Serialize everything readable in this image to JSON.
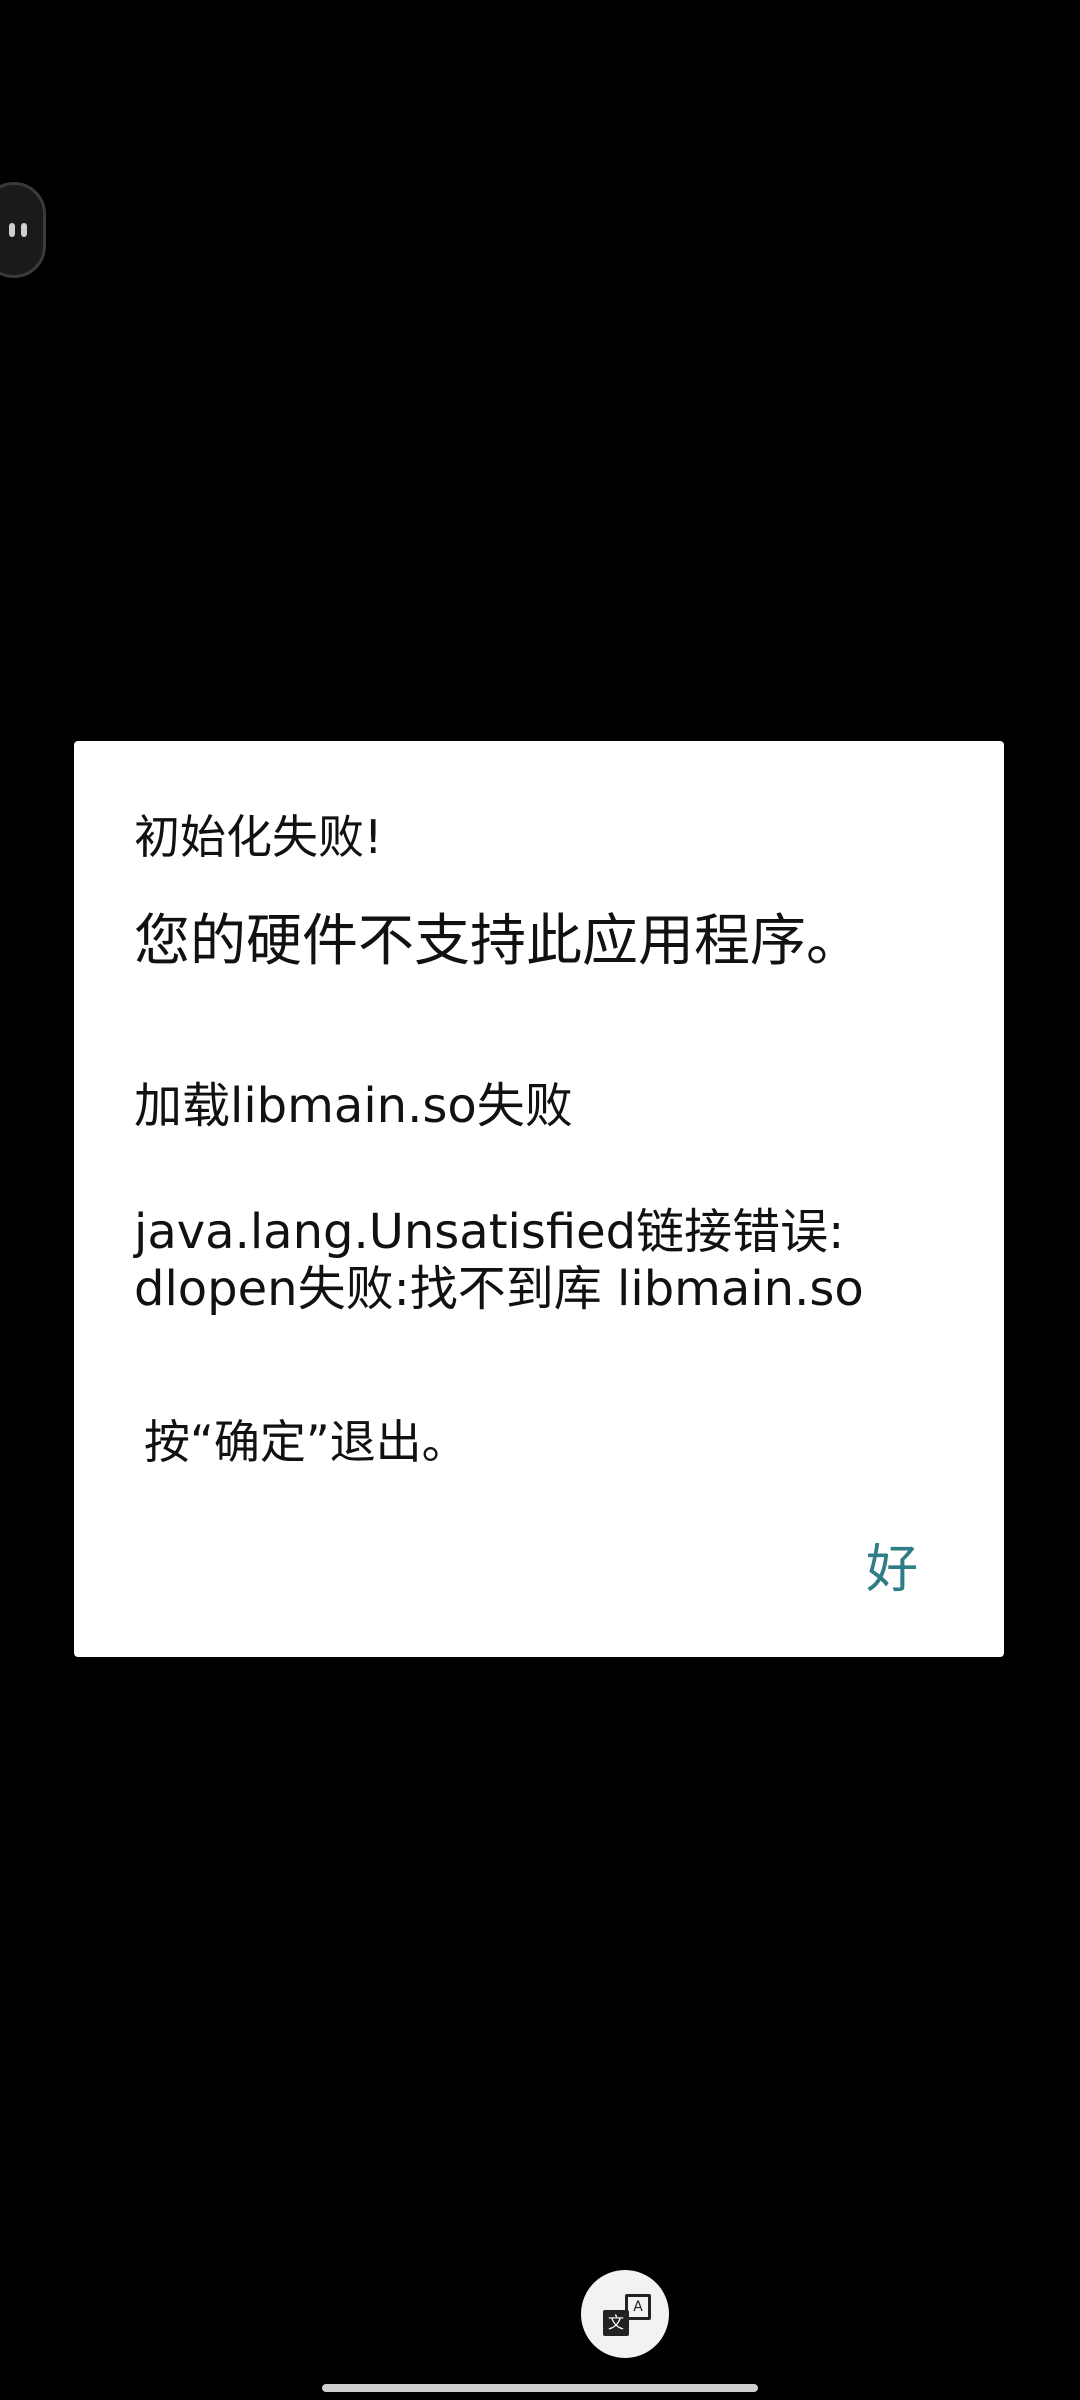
{
  "dialog": {
    "title": "初始化失败!",
    "headline": "您的硬件不支持此应用程序。",
    "load_error": "加载libmain.so失败",
    "link_error_line1": "java.lang.Unsatisfied链接错误:",
    "link_error_line2": "dlopen失败:找不到库 libmain.so",
    "exit_hint": "按“确定”退出。",
    "ok_label": "好"
  },
  "translate_button": {
    "icon": "translate-icon",
    "glyph_back": "A",
    "glyph_front": "文"
  },
  "floating_bubble": {
    "icon": "assistant-bubble-icon"
  },
  "colors": {
    "background": "#000000",
    "dialog_background": "#ffffff",
    "accent": "#2f7d86",
    "text": "#111111"
  }
}
